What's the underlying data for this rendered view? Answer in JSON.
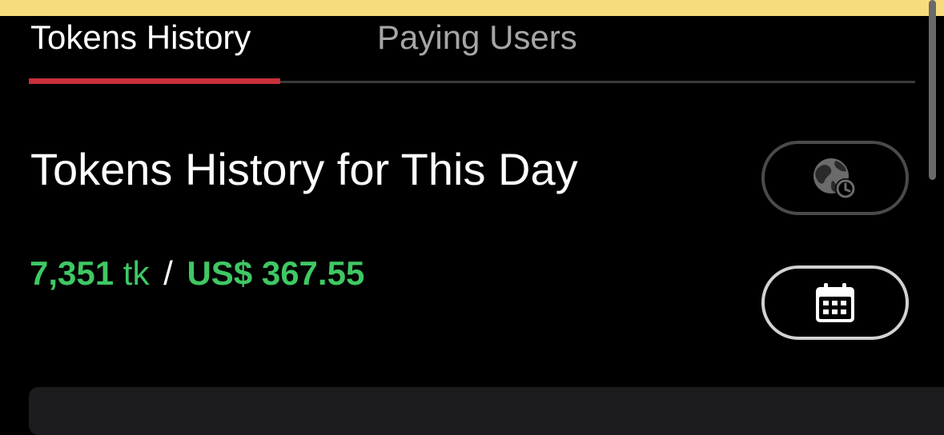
{
  "tabs": [
    {
      "label": "Tokens History",
      "active": true
    },
    {
      "label": "Paying Users",
      "active": false
    }
  ],
  "page": {
    "title": "Tokens History for This Day"
  },
  "summary": {
    "token_count": "7,351",
    "token_unit": "tk",
    "separator": "/",
    "usd_value": "US$ 367.55"
  },
  "buttons": {
    "timezone_icon": "globe-clock-icon",
    "calendar_icon": "calendar-icon"
  },
  "colors": {
    "banner": "#f7dc7e",
    "accent_red": "#c8303a",
    "value_green": "#3fc864",
    "background": "#000000",
    "inactive_tab": "#a6a6a6"
  }
}
